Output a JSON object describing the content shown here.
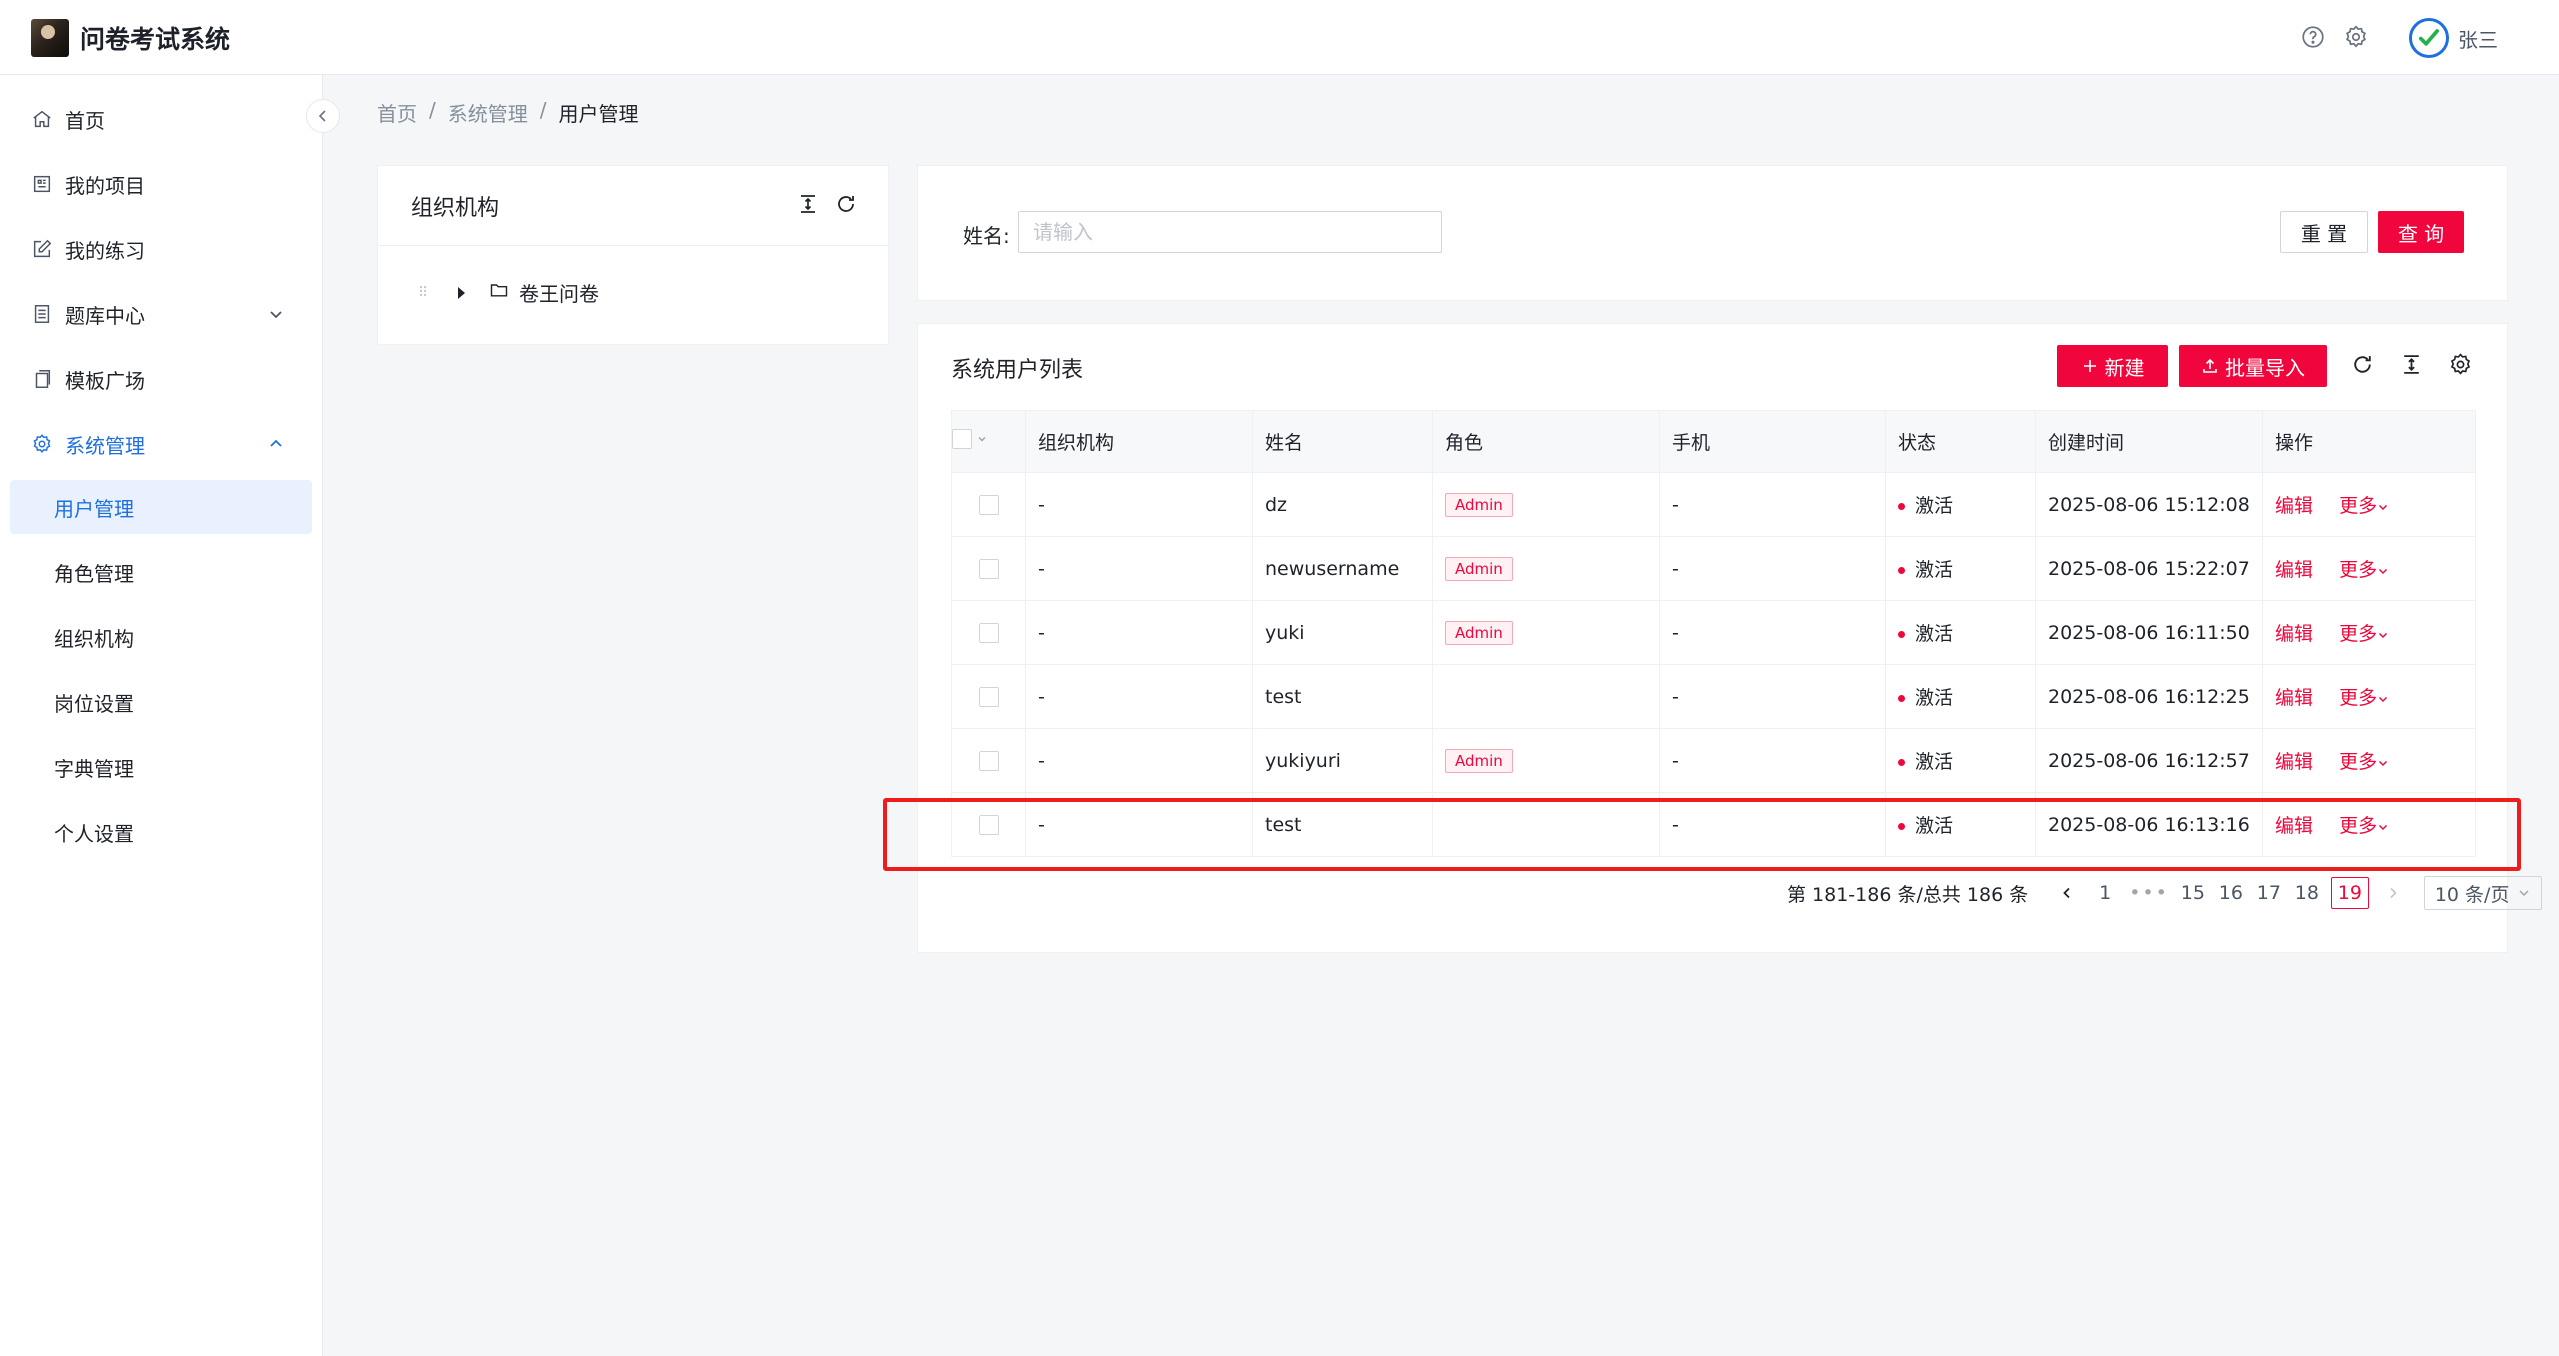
{
  "app": {
    "title": "问卷考试系统"
  },
  "header": {
    "user_name": "张三"
  },
  "sidebar": {
    "items": [
      {
        "label": "首页",
        "icon": "home-icon"
      },
      {
        "label": "我的项目",
        "icon": "project-icon"
      },
      {
        "label": "我的练习",
        "icon": "edit-icon"
      },
      {
        "label": "题库中心",
        "icon": "database-icon"
      },
      {
        "label": "模板广场",
        "icon": "template-icon"
      },
      {
        "label": "系统管理",
        "icon": "gear-icon"
      }
    ],
    "sub_items": [
      "用户管理",
      "角色管理",
      "组织机构",
      "岗位设置",
      "字典管理",
      "个人设置"
    ]
  },
  "breadcrumb": [
    "首页",
    "系统管理",
    "用户管理"
  ],
  "org_panel": {
    "title": "组织机构",
    "tree_root": "卷王问卷"
  },
  "search": {
    "label": "姓名:",
    "placeholder": "请输入",
    "value": "",
    "reset_label": "重 置",
    "query_label": "查 询"
  },
  "list": {
    "title": "系统用户列表",
    "new_label": "新建",
    "import_label": "批量导入",
    "columns": [
      "组织机构",
      "姓名",
      "角色",
      "手机",
      "状态",
      "创建时间",
      "操作"
    ],
    "edit_label": "编辑",
    "more_label": "更多",
    "rows": [
      {
        "org": "-",
        "name": "dz",
        "role": "Admin",
        "phone": "-",
        "status": "激活",
        "created": "2025-08-06 15:12:08"
      },
      {
        "org": "-",
        "name": "newusername",
        "role": "Admin",
        "phone": "-",
        "status": "激活",
        "created": "2025-08-06 15:22:07"
      },
      {
        "org": "-",
        "name": "yuki",
        "role": "Admin",
        "phone": "-",
        "status": "激活",
        "created": "2025-08-06 16:11:50"
      },
      {
        "org": "-",
        "name": "test",
        "role": "",
        "phone": "-",
        "status": "激活",
        "created": "2025-08-06 16:12:25"
      },
      {
        "org": "-",
        "name": "yukiyuri",
        "role": "Admin",
        "phone": "-",
        "status": "激活",
        "created": "2025-08-06 16:12:57"
      },
      {
        "org": "-",
        "name": "test",
        "role": "",
        "phone": "-",
        "status": "激活",
        "created": "2025-08-06 16:13:16"
      }
    ]
  },
  "pagination": {
    "total_text": "第 181-186 条/总共 186 条",
    "pages": [
      "1",
      "15",
      "16",
      "17",
      "18",
      "19"
    ],
    "current": "19",
    "page_size": "10 条/页"
  },
  "colors": {
    "accent": "#f0063c",
    "primary": "#1e6fe0",
    "highlight": "#ee1c1c"
  }
}
